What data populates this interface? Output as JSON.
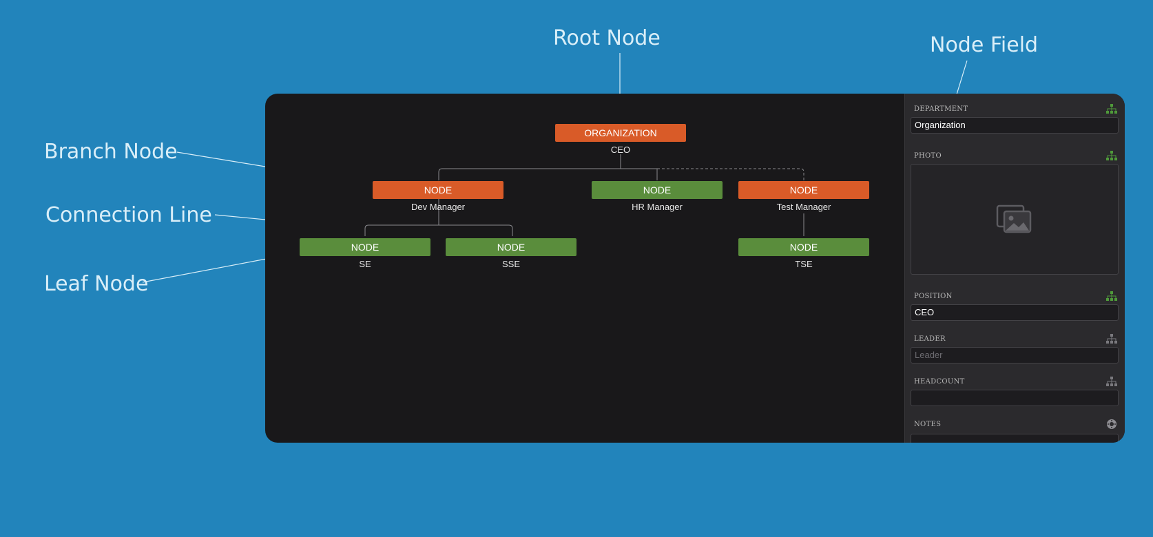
{
  "callouts": {
    "root_node": "Root Node",
    "node_field": "Node Field",
    "branch_node": "Branch Node",
    "connection_line": "Connection Line",
    "leaf_node": "Leaf Node"
  },
  "tree": {
    "root": {
      "label": "ORGANIZATION",
      "sub": "CEO"
    },
    "dev": {
      "label": "NODE",
      "sub": "Dev Manager"
    },
    "hr": {
      "label": "NODE",
      "sub": "HR Manager"
    },
    "test": {
      "label": "NODE",
      "sub": "Test Manager"
    },
    "se": {
      "label": "NODE",
      "sub": "SE"
    },
    "sse": {
      "label": "NODE",
      "sub": "SSE"
    },
    "tse": {
      "label": "NODE",
      "sub": "TSE"
    }
  },
  "panel": {
    "department": {
      "label": "DEPARTMENT",
      "value": "Organization",
      "icon": "org-chart-icon"
    },
    "photo": {
      "label": "PHOTO",
      "icon": "org-chart-icon",
      "placeholder_icon": "image-placeholder-icon"
    },
    "position": {
      "label": "POSITION",
      "value": "CEO",
      "icon": "org-chart-icon"
    },
    "leader": {
      "label": "LEADER",
      "placeholder": "Leader",
      "icon": "org-chart-icon"
    },
    "headcount": {
      "label": "HEADCOUNT",
      "value": "",
      "icon": "org-chart-icon"
    },
    "notes": {
      "label": "NOTES",
      "icon": "gear-icon"
    }
  },
  "colors": {
    "background": "#2284bb",
    "window": "#19181a",
    "panel": "#2b2a2d",
    "branch_node": "#d95b28",
    "leaf_node": "#5a8d3c",
    "callout_text": "#d9eef8"
  }
}
